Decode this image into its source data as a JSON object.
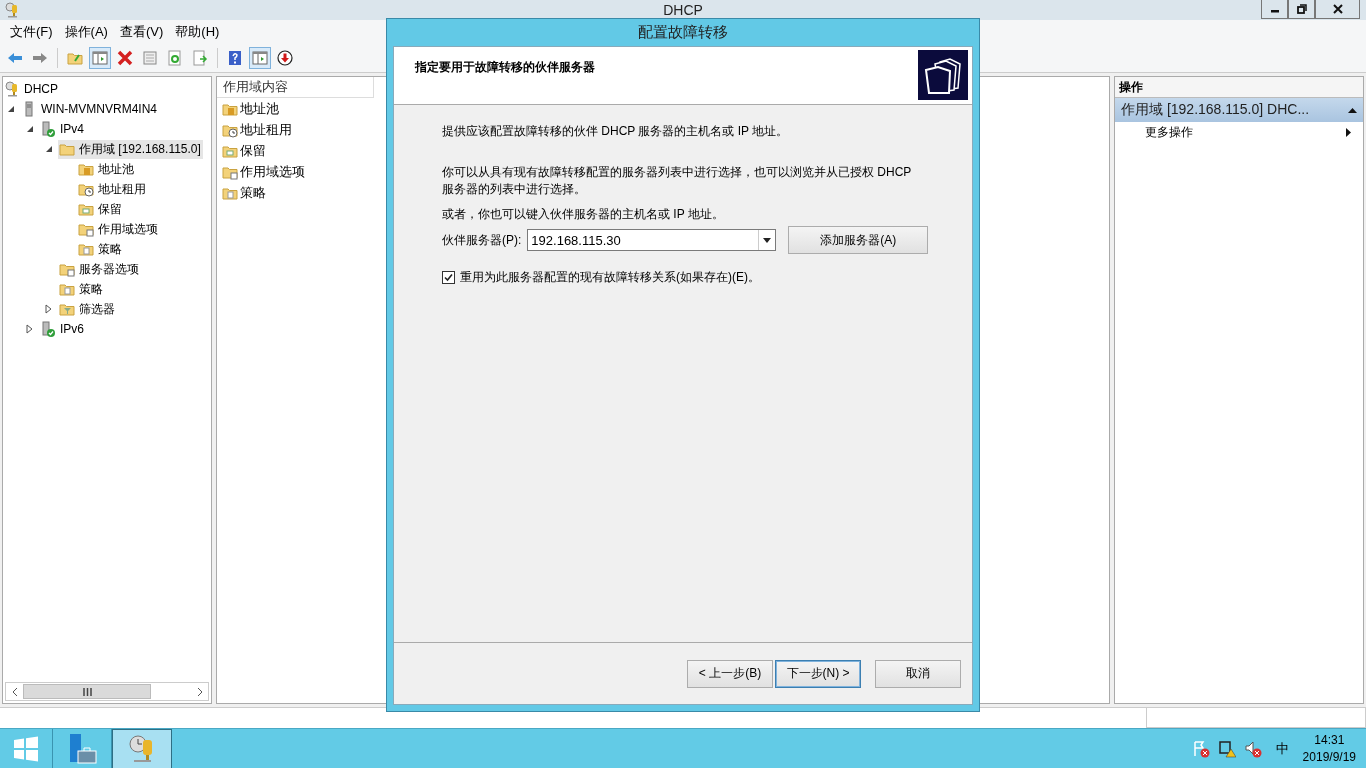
{
  "window": {
    "title": "DHCP"
  },
  "menu": [
    "文件(F)",
    "操作(A)",
    "查看(V)",
    "帮助(H)"
  ],
  "toolbar": [
    {
      "kind": "back"
    },
    {
      "kind": "forward"
    },
    {
      "kind": "sep"
    },
    {
      "kind": "up"
    },
    {
      "kind": "tree-pane",
      "pressed": true
    },
    {
      "kind": "delete"
    },
    {
      "kind": "properties"
    },
    {
      "kind": "refresh"
    },
    {
      "kind": "export"
    },
    {
      "kind": "sep"
    },
    {
      "kind": "help"
    },
    {
      "kind": "action-pane",
      "pressed": true
    },
    {
      "kind": "download"
    }
  ],
  "tree": [
    {
      "label": "DHCP",
      "kind": "dhcp",
      "selected": false,
      "children": [
        {
          "label": "WIN-MVMNVRM4IN4",
          "kind": "server",
          "expanded": true,
          "selected": false,
          "children": [
            {
              "label": "IPv4",
              "kind": "ip",
              "expanded": true,
              "selected": false,
              "children": [
                {
                  "label": "作用域 [192.168.115.0]",
                  "kind": "folder",
                  "expanded": true,
                  "selected": true,
                  "children": [
                    {
                      "label": "地址池",
                      "kind": "pool",
                      "selected": false
                    },
                    {
                      "label": "地址租用",
                      "kind": "lease",
                      "selected": false
                    },
                    {
                      "label": "保留",
                      "kind": "reserve",
                      "selected": false
                    },
                    {
                      "label": "作用域选项",
                      "kind": "options",
                      "selected": false
                    },
                    {
                      "label": "策略",
                      "kind": "policy",
                      "selected": false
                    }
                  ]
                },
                {
                  "label": "服务器选项",
                  "kind": "options",
                  "selected": false
                },
                {
                  "label": "策略",
                  "kind": "policy",
                  "selected": false
                },
                {
                  "label": "筛选器",
                  "kind": "filter",
                  "expanded": false,
                  "selected": false
                }
              ]
            },
            {
              "label": "IPv6",
              "kind": "ip",
              "expanded": false,
              "selected": false
            }
          ]
        }
      ]
    }
  ],
  "content": {
    "column": "作用域内容",
    "items": [
      {
        "label": "地址池",
        "kind": "pool"
      },
      {
        "label": "地址租用",
        "kind": "lease"
      },
      {
        "label": "保留",
        "kind": "reserve"
      },
      {
        "label": "作用域选项",
        "kind": "options"
      },
      {
        "label": "策略",
        "kind": "policy"
      }
    ]
  },
  "actions": {
    "header": "操作",
    "section": {
      "label": "作用域 [192.168.115.0] DHC...",
      "expanded": true
    },
    "items": [
      "更多操作"
    ]
  },
  "dialog": {
    "title": "配置故障转移",
    "heading": "指定要用于故障转移的伙伴服务器",
    "intro": "提供应该配置故障转移的伙伴 DHCP 服务器的主机名或 IP 地址。",
    "paragraph": "你可以从具有现有故障转移配置的服务器列表中进行选择，也可以浏览并从已授权 DHCP 服务器的列表中进行选择。",
    "alternative": "或者，你也可以键入伙伴服务器的主机名或 IP 地址。",
    "partner_label": "伙伴服务器(P):",
    "partner_value": "192.168.115.30",
    "add_button": "添加服务器(A)",
    "reuse": {
      "label": "重用为此服务器配置的现有故障转移关系(如果存在)(E)。",
      "checked": true
    },
    "buttons": [
      {
        "label": "< 上一步(B)",
        "default": false
      },
      {
        "label": "下一步(N) >",
        "default": true
      },
      {
        "label": "取消",
        "default": false
      }
    ]
  },
  "taskbar": {
    "apps": [
      {
        "kind": "server-manager",
        "active": false
      },
      {
        "kind": "dhcp",
        "active": true
      }
    ],
    "ime": "中",
    "time": "14:31",
    "date": "2019/9/19"
  }
}
